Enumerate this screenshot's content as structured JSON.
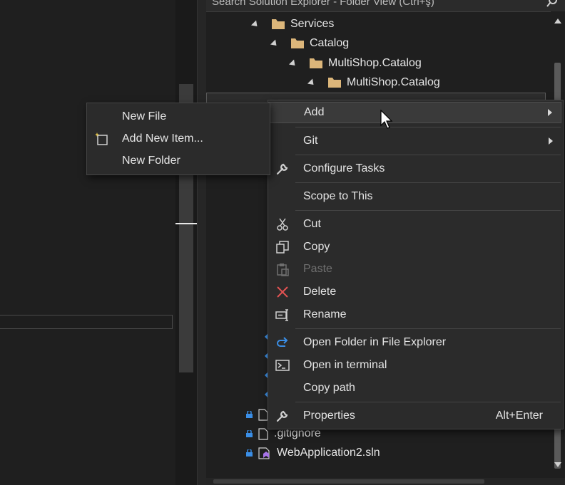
{
  "search": {
    "placeholder": "Search Solution Explorer - Folder View (Ctrl+ş)"
  },
  "tree": {
    "services": "Services",
    "catalog": "Catalog",
    "multishop_catalog_1": "MultiShop.Catalog",
    "multishop_catalog_2": "MultiShop.Catalog",
    "gitignore": ".gitignore",
    "sln": "WebApplication2.sln"
  },
  "context_menu": {
    "add": "Add",
    "git": "Git",
    "configure_tasks": "Configure Tasks",
    "scope_to_this": "Scope to This",
    "cut": "Cut",
    "copy": "Copy",
    "paste": "Paste",
    "delete": "Delete",
    "rename": "Rename",
    "open_folder": "Open Folder in File Explorer",
    "open_terminal": "Open in terminal",
    "copy_path": "Copy path",
    "properties": "Properties",
    "properties_shortcut": "Alt+Enter"
  },
  "add_submenu": {
    "new_file": "New File",
    "add_new_item": "Add New Item...",
    "new_folder": "New Folder"
  },
  "colors": {
    "folder": "#dcb67a",
    "accent_blue": "#3a8ee6",
    "delete_red": "#e05252",
    "menu_bg": "#2b2b2b"
  }
}
